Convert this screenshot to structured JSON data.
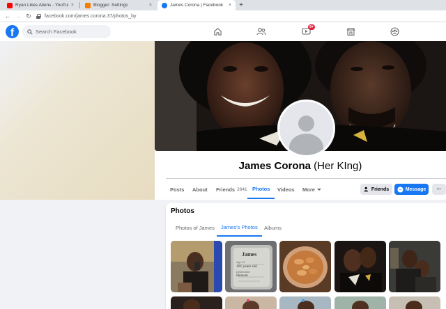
{
  "browser": {
    "tabs": [
      {
        "title": "Ryan Likes Aliens - YouTube",
        "icon": "youtube-icon",
        "color": "#ff0000"
      },
      {
        "title": "Blogger: Settings",
        "icon": "blogger-icon",
        "color": "#f57d00"
      },
      {
        "title": "James Corona | Facebook",
        "icon": "facebook-icon",
        "color": "#1877f2"
      }
    ],
    "new_tab": "+",
    "close": "×",
    "url": "facebook.com/james.corona.37/photos_by"
  },
  "header": {
    "logo": "f",
    "search_placeholder": "Search Facebook",
    "nav_icons": [
      "home-icon",
      "friends-icon",
      "watch-icon",
      "marketplace-icon",
      "groups-icon"
    ],
    "watch_badge": "9+",
    "accent": "#1877f2"
  },
  "profile": {
    "name": "James Corona",
    "nickname": "(Her KIng)",
    "tabs": [
      {
        "label": "Posts"
      },
      {
        "label": "About"
      },
      {
        "label": "Friends",
        "count": "2641"
      },
      {
        "label": "Photos"
      },
      {
        "label": "Videos"
      },
      {
        "label": "More"
      }
    ],
    "active_tab": "Photos",
    "buttons": {
      "friends": "Friends",
      "message": "Message",
      "more": "···"
    }
  },
  "photos": {
    "title": "Photos",
    "subtabs": [
      "Photos of James",
      "James's Photos",
      "Albums"
    ],
    "active_subtab": "James's Photos",
    "memorial": {
      "name": "James",
      "age_label": "Age 22",
      "age": "101 years old",
      "place_label": "Destination",
      "place": "Heaven"
    }
  }
}
